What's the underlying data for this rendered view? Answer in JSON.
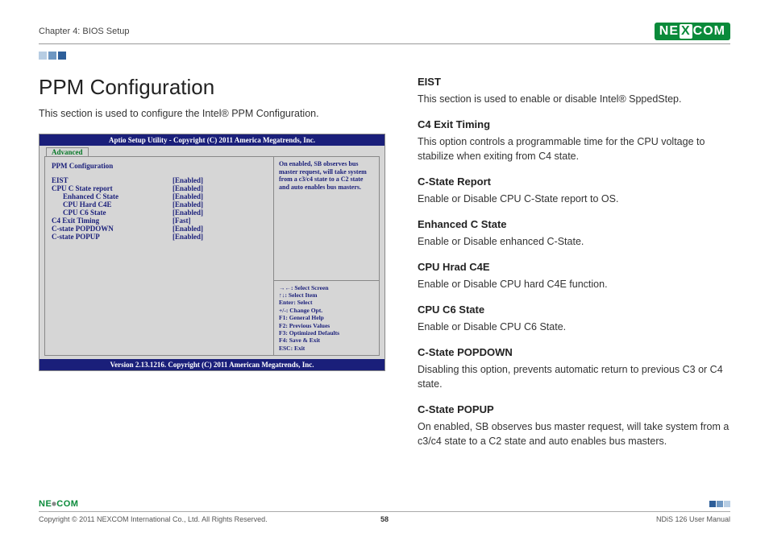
{
  "header": {
    "chapter": "Chapter 4: BIOS Setup",
    "brand": "NEXCOM"
  },
  "title": "PPM Configuration",
  "intro": "This section is used to configure the Intel® PPM Configuration.",
  "bios": {
    "top": "Aptio Setup Utility - Copyright (C) 2011 America Megatrends, Inc.",
    "tab": "Advanced",
    "section_title": "PPM Configuration",
    "rows": [
      {
        "label": "EIST",
        "value": "[Enabled]",
        "indent": 0
      },
      {
        "label": "CPU C State report",
        "value": "[Enabled]",
        "indent": 0
      },
      {
        "label": "Enhanced C State",
        "value": "[Enabled]",
        "indent": 1
      },
      {
        "label": "CPU Hard C4E",
        "value": "[Enabled]",
        "indent": 1
      },
      {
        "label": "CPU C6 State",
        "value": "[Enabled]",
        "indent": 1
      },
      {
        "label": "C4 Exit Timing",
        "value": "[Fast]",
        "indent": 0
      },
      {
        "label": "C-state POPDOWN",
        "value": "[Enabled]",
        "indent": 0
      },
      {
        "label": "C-state POPUP",
        "value": "[Enabled]",
        "indent": 0
      }
    ],
    "help": "On enabled, SB observes bus master request, will take system from a c3/c4 state to a C2 state and auto enables bus masters.",
    "keys": [
      "→←: Select Screen",
      "↑↓: Select Item",
      "Enter: Select",
      "+/-: Change Opt.",
      "F1: General Help",
      "F2: Previous Values",
      "F3: Optimized Defaults",
      "F4: Save & Exit",
      "ESC: Exit"
    ],
    "bottom": "Version 2.13.1216. Copyright (C) 2011 American Megatrends, Inc."
  },
  "sections": [
    {
      "h": "EIST",
      "p": "This section is used to enable or disable Intel® SppedStep."
    },
    {
      "h": "C4 Exit Timing",
      "p": "This option controls a programmable time for the CPU voltage to stabilize when exiting from C4 state."
    },
    {
      "h": "C-State Report",
      "p": "Enable or Disable CPU C-State report to OS."
    },
    {
      "h": "Enhanced C State",
      "p": "Enable or Disable enhanced C-State."
    },
    {
      "h": "CPU Hrad C4E",
      "p": "Enable or Disable CPU hard C4E function."
    },
    {
      "h": "CPU C6 State",
      "p": "Enable or Disable CPU C6 State."
    },
    {
      "h": "C-State POPDOWN",
      "p": "Disabling this option, prevents automatic return to previous C3 or C4 state."
    },
    {
      "h": "C-State POPUP",
      "p": "On enabled, SB observes bus master request, will take system from a c3/c4 state to a C2 state and auto enables bus masters."
    }
  ],
  "footer": {
    "brand": "NE COM",
    "copyright": "Copyright © 2011 NEXCOM International Co., Ltd. All Rights Reserved.",
    "page": "58",
    "doc": "NDiS 126 User Manual"
  }
}
